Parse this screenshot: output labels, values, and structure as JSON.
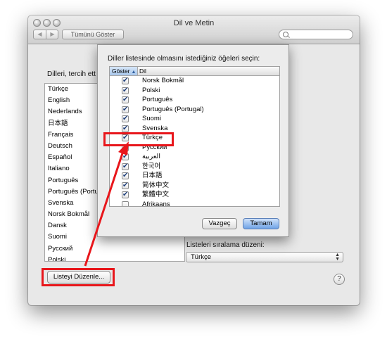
{
  "window": {
    "title": "Dil ve Metin"
  },
  "toolbar": {
    "back_icon": "◀",
    "forward_icon": "▶",
    "show_all_label": "Tümünü Göster",
    "search_placeholder": ""
  },
  "main": {
    "preferred_label": "Dilleri, tercih ett",
    "languages": [
      "Türkçe",
      "English",
      "Nederlands",
      "日本語",
      "Français",
      "Deutsch",
      "Español",
      "Italiano",
      "Português",
      "Português (Portu",
      "Svenska",
      "Norsk Bokmål",
      "Dansk",
      "Suomi",
      "Русский",
      "Polski"
    ],
    "edit_list_label": "Listeyi Düzenle...",
    "sort_order_label": "Listeleri sıralama düzeni:",
    "sort_order_value": "Türkçe",
    "help_label": "?"
  },
  "sheet": {
    "instruction": "Diller listesinde olmasını istediğiniz öğeleri seçin:",
    "col_show": "Göster",
    "col_lang": "Dil",
    "sort_indicator": "▲",
    "check_glyph": "✔",
    "rows": [
      {
        "name": "Norsk Bokmål",
        "checked": true
      },
      {
        "name": "Polski",
        "checked": true
      },
      {
        "name": "Português",
        "checked": true
      },
      {
        "name": "Português (Portugal)",
        "checked": true
      },
      {
        "name": "Suomi",
        "checked": true
      },
      {
        "name": "Svenska",
        "checked": true
      },
      {
        "name": "Türkçe",
        "checked": true
      },
      {
        "name": "Русский",
        "checked": true
      },
      {
        "name": "العربية",
        "checked": true
      },
      {
        "name": "한국어",
        "checked": true
      },
      {
        "name": "日本語",
        "checked": true
      },
      {
        "name": "简体中文",
        "checked": true
      },
      {
        "name": "繁體中文",
        "checked": true
      },
      {
        "name": "Afrikaans",
        "checked": false
      }
    ],
    "cancel_label": "Vazgeç",
    "ok_label": "Tamam"
  },
  "annotation": {
    "color": "#e8161b"
  }
}
